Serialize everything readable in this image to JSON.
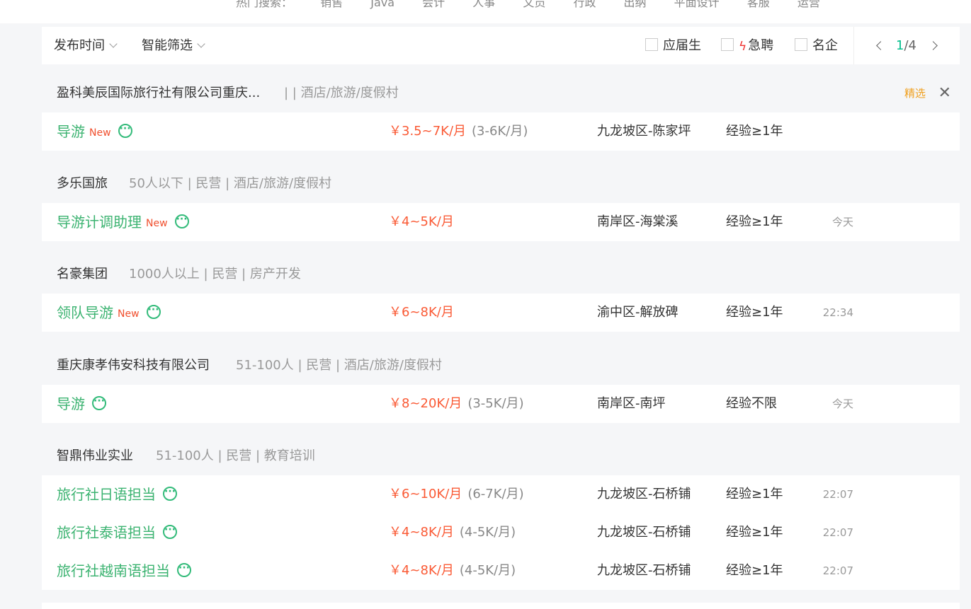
{
  "hot_search": {
    "label": "热门搜索：",
    "terms": [
      "销售",
      "Java",
      "会计",
      "人事",
      "文员",
      "行政",
      "出纳",
      "平面设计",
      "客服",
      "运营"
    ]
  },
  "filters": {
    "publish_time": "发布时间",
    "smart_filter": "智能筛选",
    "checkbox_graduate": "应届生",
    "checkbox_urgent": "急聘",
    "checkbox_famous": "名企",
    "page_current": "1",
    "page_total": "/4"
  },
  "colors": {
    "accent": "#00be8c",
    "job_title": "#3cb371",
    "salary": "#fa5a35",
    "new_badge": "#f0502f",
    "featured": "#f0a020"
  },
  "companies": [
    {
      "name": "盈科美辰国际旅行社有限公司重庆...",
      "meta": "| | 酒店/旅游/度假村",
      "featured": "精选",
      "close": "✕",
      "jobs": [
        {
          "title": "导游",
          "new": "New",
          "salary": "￥3.5~7K/月",
          "alt": "(3-6K/月)",
          "location": "九龙坡区-陈家坪",
          "experience": "经验≥1年",
          "time": ""
        }
      ]
    },
    {
      "name": "多乐国旅",
      "meta": "50人以下 | 民营 | 酒店/旅游/度假村",
      "jobs": [
        {
          "title": "导游计调助理",
          "new": "New",
          "salary": "￥4~5K/月",
          "alt": "",
          "location": "南岸区-海棠溪",
          "experience": "经验≥1年",
          "time": "今天"
        }
      ]
    },
    {
      "name": "名豪集团",
      "meta": "1000人以上 | 民营 | 房产开发",
      "jobs": [
        {
          "title": "领队导游",
          "new": "New",
          "salary": "￥6~8K/月",
          "alt": "",
          "location": "渝中区-解放碑",
          "experience": "经验≥1年",
          "time": "22:34"
        }
      ]
    },
    {
      "name": "重庆康孝伟安科技有限公司",
      "meta": "51-100人 | 民营 | 酒店/旅游/度假村",
      "jobs": [
        {
          "title": "导游",
          "new": "",
          "salary": "￥8~20K/月",
          "alt": "(3-5K/月)",
          "location": "南岸区-南坪",
          "experience": "经验不限",
          "time": "今天"
        }
      ]
    },
    {
      "name": "智鼎伟业实业",
      "meta": "51-100人 | 民营 | 教育培训",
      "jobs": [
        {
          "title": "旅行社日语担当",
          "new": "",
          "salary": "￥6~10K/月",
          "alt": "(6-7K/月)",
          "location": "九龙坡区-石桥铺",
          "experience": "经验≥1年",
          "time": "22:07"
        },
        {
          "title": "旅行社泰语担当",
          "new": "",
          "salary": "￥4~8K/月",
          "alt": "(4-5K/月)",
          "location": "九龙坡区-石桥铺",
          "experience": "经验≥1年",
          "time": "22:07"
        },
        {
          "title": "旅行社越南语担当",
          "new": "",
          "salary": "￥4~8K/月",
          "alt": "(4-5K/月)",
          "location": "九龙坡区-石桥铺",
          "experience": "经验≥1年",
          "time": "22:07"
        }
      ]
    }
  ]
}
